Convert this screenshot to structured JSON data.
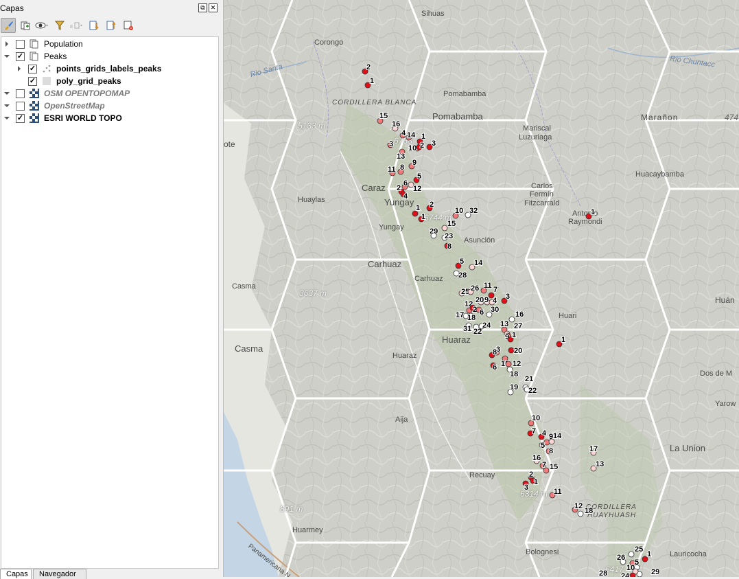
{
  "panel": {
    "title": "Capas",
    "float_glyph": "⧉",
    "close_glyph": "✕"
  },
  "toolbar": {
    "icons": [
      "style-brush-icon",
      "add-group-icon",
      "visibility-eye-icon",
      "filter-icon",
      "expression-filter-icon",
      "expand-all-icon",
      "collapse-all-icon",
      "remove-layer-icon"
    ]
  },
  "layers": [
    {
      "label": "Population",
      "checked": false,
      "expanded": false,
      "style": "normal"
    },
    {
      "label": "Peaks",
      "checked": true,
      "expanded": true,
      "style": "normal"
    },
    {
      "label": "points_grids_labels_peaks",
      "checked": true,
      "expanded": false,
      "style": "bold"
    },
    {
      "label": "poly_grid_peaks",
      "checked": true,
      "expanded": false,
      "style": "bold"
    },
    {
      "label": "OSM OPENTOPOMAP",
      "checked": false,
      "expanded": true,
      "style": "italic"
    },
    {
      "label": "OpenStreetMap",
      "checked": false,
      "expanded": true,
      "style": "italic"
    },
    {
      "label": "ESRI WORLD TOPO",
      "checked": true,
      "expanded": true,
      "style": "bold"
    }
  ],
  "bottom_tabs": [
    "Capas",
    "Navegador"
  ],
  "map": {
    "places": {
      "sihuas": "Sihuas",
      "corongo": "Corongo",
      "pomabamba_small": "Pomabamba",
      "pomabamba": "Pomabamba",
      "cordillera_blanca": "CORDILLERA BLANCA",
      "rio_santa": "Rio Santa",
      "mariscal": "Mariscal",
      "luzuriaga": "Luzuriaga",
      "maranon": "Marañon",
      "rio_chuntacc": "Rio Chuntacc",
      "caraz": "Caraz",
      "huaylas": "Huaylas",
      "yungay": "Yungay",
      "yungay_small": "Yungay",
      "carlos_fermin": "Carlos",
      "fermin": "Fermín",
      "fitzcarrald": "Fitzcarrald",
      "huacaybamba": "Huacaybamba",
      "antonio": "Antonio",
      "raymondi": "Raymondi",
      "asuncion": "Asunción",
      "carhuaz": "Carhuaz",
      "carhuaz_small": "Carhuaz",
      "casma_small": "Casma",
      "casma": "Casma",
      "huaraz": "Huaraz",
      "huaraz_small": "Huaraz",
      "huari": "Huari",
      "huanuco": "Huán",
      "dos_de_mayo": "Dos de M",
      "yarowilca": "Yarow",
      "aija": "Aija",
      "recuay": "Recuay",
      "la_union": "La Union",
      "huarmey": "Huarmey",
      "cordillera_huayhuash": "CORDILLERA",
      "huayhuash": "HUAYHUASH",
      "bolognesi": "Bolognesi",
      "lauricocha": "Lauricocha",
      "pan_norte": "Panamericana N",
      "ote": "ote"
    },
    "elevations": {
      "e5133": "5133 m",
      "e3637": "3637 m",
      "e891": "891 m",
      "e6744": "6744 m",
      "e474": "474",
      "e6768": "6768",
      "e6314": "6314 m",
      "e6417": "6417"
    }
  },
  "peak_labels": [
    "2",
    "1",
    "15",
    "16",
    "4",
    "14",
    "1",
    "3",
    "10",
    "3",
    "2",
    "13",
    "9",
    "11",
    "8",
    "5",
    "6",
    "12",
    "2",
    "4",
    "2",
    "1",
    "1",
    "10",
    "32",
    "15",
    "29",
    "23",
    "8",
    "5",
    "14",
    "28",
    "25",
    "26",
    "11",
    "7",
    "3",
    "20",
    "9",
    "4",
    "12",
    "2",
    "6",
    "30",
    "17",
    "18",
    "16",
    "31",
    "22",
    "24",
    "13",
    "27",
    "9",
    "1",
    "3",
    "8",
    "20",
    "15",
    "12",
    "6",
    "18",
    "21",
    "19",
    "22",
    "10",
    "7",
    "4",
    "9",
    "14",
    "5",
    "8",
    "17",
    "16",
    "7",
    "15",
    "13",
    "2",
    "3",
    "1",
    "11",
    "12",
    "18",
    "1",
    "1",
    "25",
    "1",
    "26",
    "5",
    "10",
    "28",
    "29",
    "24"
  ],
  "colors": {
    "hex_line": "#ffffff",
    "point_dark": "#e0101a",
    "point_mid": "#f07a7a",
    "point_light": "#fbd4d4",
    "point_white": "#ffffff"
  }
}
